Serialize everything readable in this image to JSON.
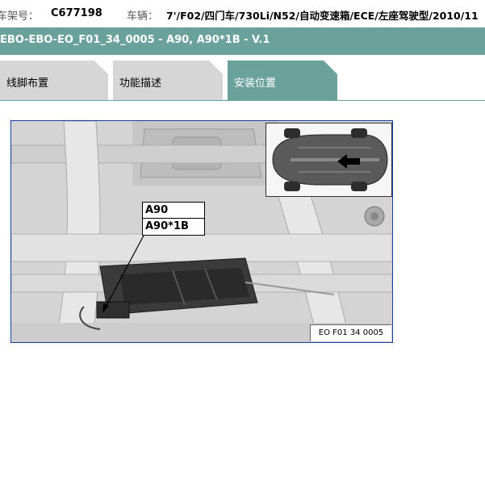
{
  "vehicle_info": {
    "vin_label": "车架号：",
    "vin_value": "C677198",
    "vehicle_label": "车辆：",
    "vehicle_value": "7'/F02/四门车/730Li/N52/自动变速箱/ECE/左座驾驶型/2010/11"
  },
  "document_title": "EBO-EBO-EO_F01_34_0005 - A90, A90*1B - V.1",
  "tabs": [
    {
      "label": "线脚布置",
      "active": false
    },
    {
      "label": "功能描述",
      "active": false
    },
    {
      "label": "安装位置",
      "active": true
    }
  ],
  "figure": {
    "callouts": [
      "A90",
      "A90*1B"
    ],
    "caption": "EO F01 34 0005"
  },
  "colors": {
    "accent": "#6aa19b",
    "tab_inactive": "#d6d6d6",
    "figure_border": "#1a3ea0"
  }
}
